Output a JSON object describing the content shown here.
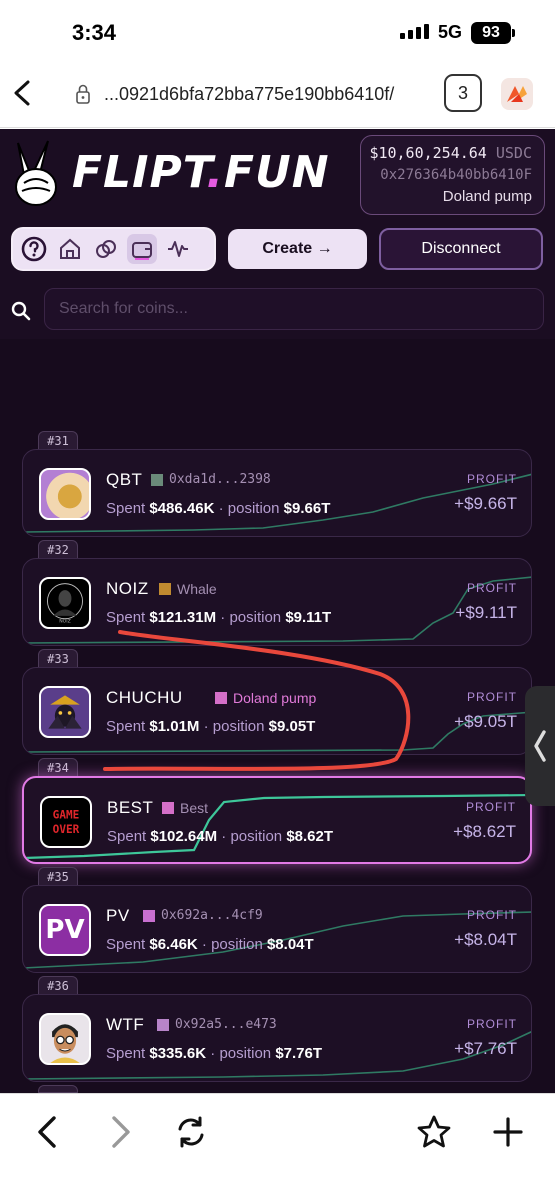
{
  "status": {
    "time": "3:34",
    "network": "5G",
    "battery": "93"
  },
  "browser": {
    "url": "...0921d6bfa72bba775e190bb6410f/",
    "tab_count": "3"
  },
  "app": {
    "logo_main": "FLIPT",
    "logo_dot": ".",
    "logo_tail": "FUN",
    "wallet": {
      "balance": "$10,60,254.64",
      "currency": "USDC",
      "address": "0x276364b40bb6410F",
      "name": "Doland pump"
    },
    "create_label": "Create →",
    "disconnect_label": "Disconnect",
    "search_placeholder": "Search for coins..."
  },
  "colors": {
    "accent": "#e45be0",
    "bg": "#170b1d",
    "profit_line": "#3ec79a"
  },
  "cards": [
    {
      "rank": "#31",
      "ticker": "QBT",
      "creator": "0xda1d...2398",
      "spent": "$486.46K",
      "position": "$9.66T",
      "profit_label": "PROFIT",
      "profit": "+$9.66T"
    },
    {
      "rank": "#32",
      "ticker": "NOIZ",
      "creator": "Whale",
      "spent": "$121.31M",
      "position": "$9.11T",
      "profit_label": "PROFIT",
      "profit": "+$9.11T"
    },
    {
      "rank": "#33",
      "ticker": "CHUCHU",
      "creator": "Doland pump",
      "spent": "$1.01M",
      "position": "$9.05T",
      "profit_label": "PROFIT",
      "profit": "+$9.05T"
    },
    {
      "rank": "#34",
      "ticker": "BEST",
      "creator": "Best",
      "spent": "$102.64M",
      "position": "$8.62T",
      "profit_label": "PROFIT",
      "profit": "+$8.62T"
    },
    {
      "rank": "#35",
      "ticker": "PV",
      "creator": "0x692a...4cf9",
      "spent": "$6.46K",
      "position": "$8.04T",
      "profit_label": "PROFIT",
      "profit": "+$8.04T"
    },
    {
      "rank": "#36",
      "ticker": "WTF",
      "creator": "0x92a5...e473",
      "spent": "$335.6K",
      "position": "$7.76T",
      "profit_label": "PROFIT",
      "profit": "+$7.76T"
    }
  ],
  "labels": {
    "spent": "Spent",
    "position": "position",
    "avatar_pv": "PV",
    "avatar_best_top": "GAME",
    "avatar_best_bottom": "OVER",
    "avatar_noiz": "NOIZ"
  }
}
